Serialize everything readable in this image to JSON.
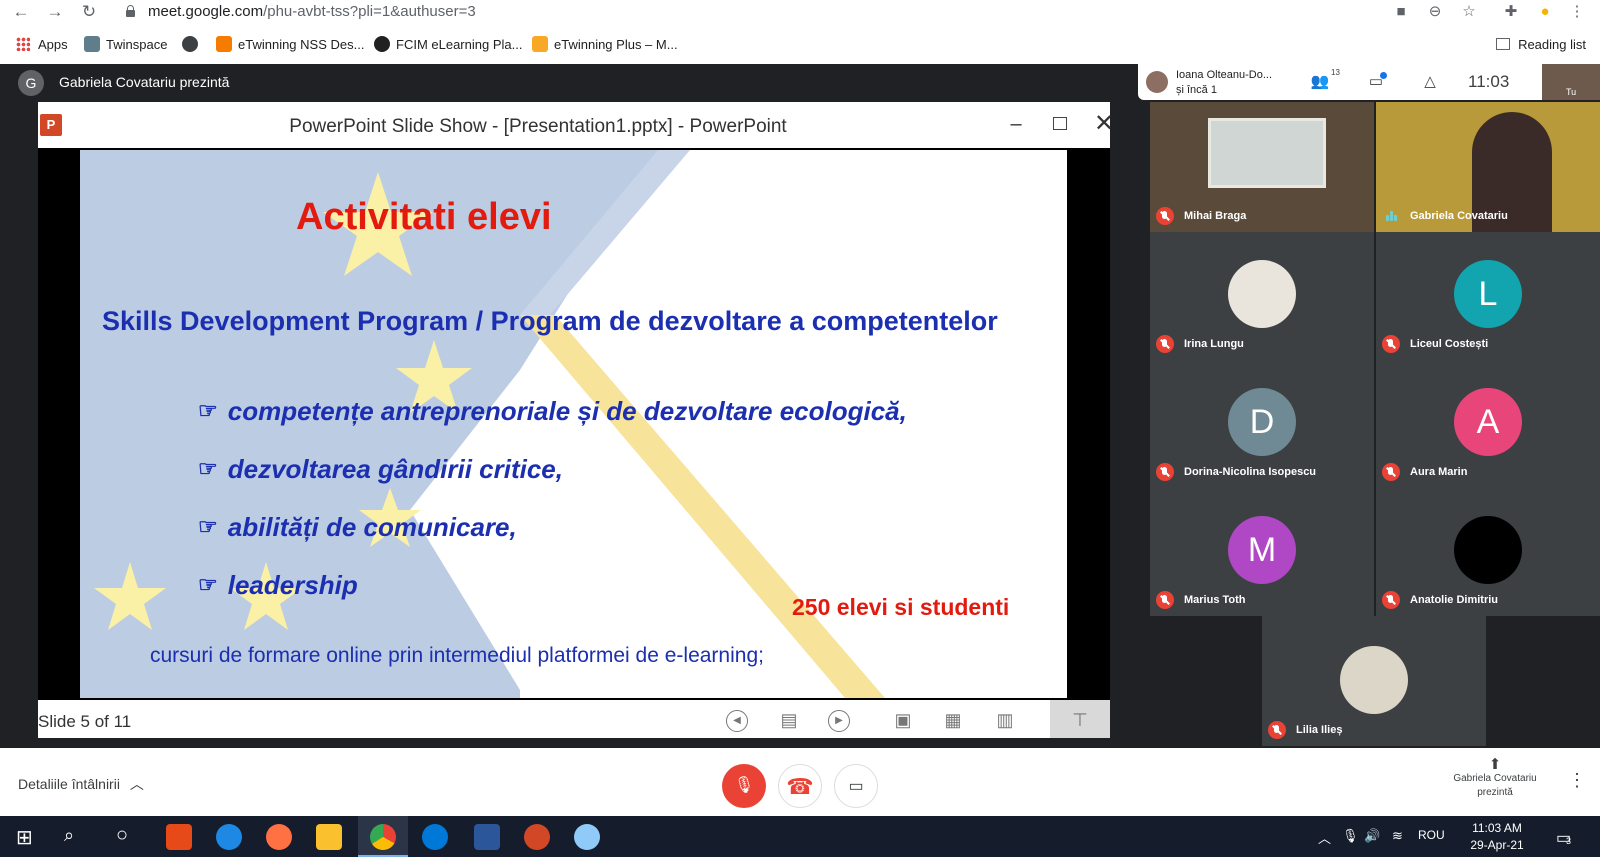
{
  "browser": {
    "url_host": "meet.google.com",
    "url_path": "/phu-avbt-tss?pli=1&authuser=3",
    "bookmarks": [
      {
        "label": "Apps"
      },
      {
        "label": "Twinspace"
      },
      {
        "label": ""
      },
      {
        "label": "eTwinning NSS Des..."
      },
      {
        "label": "FCIM eLearning Pla..."
      },
      {
        "label": "eTwinning Plus – M..."
      }
    ],
    "reading_list": "Reading list"
  },
  "meet": {
    "presenter_initial": "G",
    "presenter_label": "Gabriela Covatariu prezintă",
    "top_bar": {
      "names_line1": "Ioana Olteanu-Do...",
      "names_line2": "și încă 1",
      "participant_count": "13",
      "time": "11:03",
      "self_label": "Tu"
    },
    "tiles": [
      {
        "name": "Mihai Braga",
        "muted": true
      },
      {
        "name": "Gabriela Covatariu",
        "muted": false,
        "speaking": true
      },
      {
        "name": "Irina Lungu",
        "muted": true
      },
      {
        "name": "Liceul Costești",
        "muted": true,
        "initial": "L",
        "color": "#12a4af"
      },
      {
        "name": "Dorina-Nicolina Isopescu",
        "muted": true,
        "initial": "D",
        "color": "#6f8a95"
      },
      {
        "name": "Aura Marin",
        "muted": true,
        "initial": "A",
        "color": "#e8457a"
      },
      {
        "name": "Marius Toth",
        "muted": true,
        "initial": "M",
        "color": "#b047c4"
      },
      {
        "name": "Anatolie Dimitriu",
        "muted": true
      },
      {
        "name": "Lilia Ilieș",
        "muted": true
      }
    ],
    "bottom": {
      "meeting_details": "Detaliile întâlnirii",
      "presenting_line1": "Gabriela Covatariu",
      "presenting_line2": "prezintă"
    }
  },
  "powerpoint": {
    "window_title": "PowerPoint Slide Show - [Presentation1.pptx] - PowerPoint",
    "status": "Slide 5 of 11",
    "slide": {
      "title": "Activitati elevi",
      "subtitle": "Skills Development Program / Program de dezvoltare a competentelor",
      "bullet_glyph": "☞",
      "bullets": [
        "competențe antreprenoriale și de dezvoltare ecologică,",
        "dezvoltarea gândirii critice,",
        "abilități de comunicare,",
        "leadership"
      ],
      "count_text": "250 elevi si studenti",
      "footer": "cursuri de formare online prin intermediul platformei de e-learning;"
    }
  },
  "taskbar": {
    "language": "ROU",
    "time": "11:03 AM",
    "date": "29-Apr-21",
    "notifications": "3"
  },
  "colors": {
    "slide_title": "#e31b0f",
    "slide_text": "#1b2fb0",
    "muted_red": "#ea4335",
    "meet_dark": "#202124"
  }
}
